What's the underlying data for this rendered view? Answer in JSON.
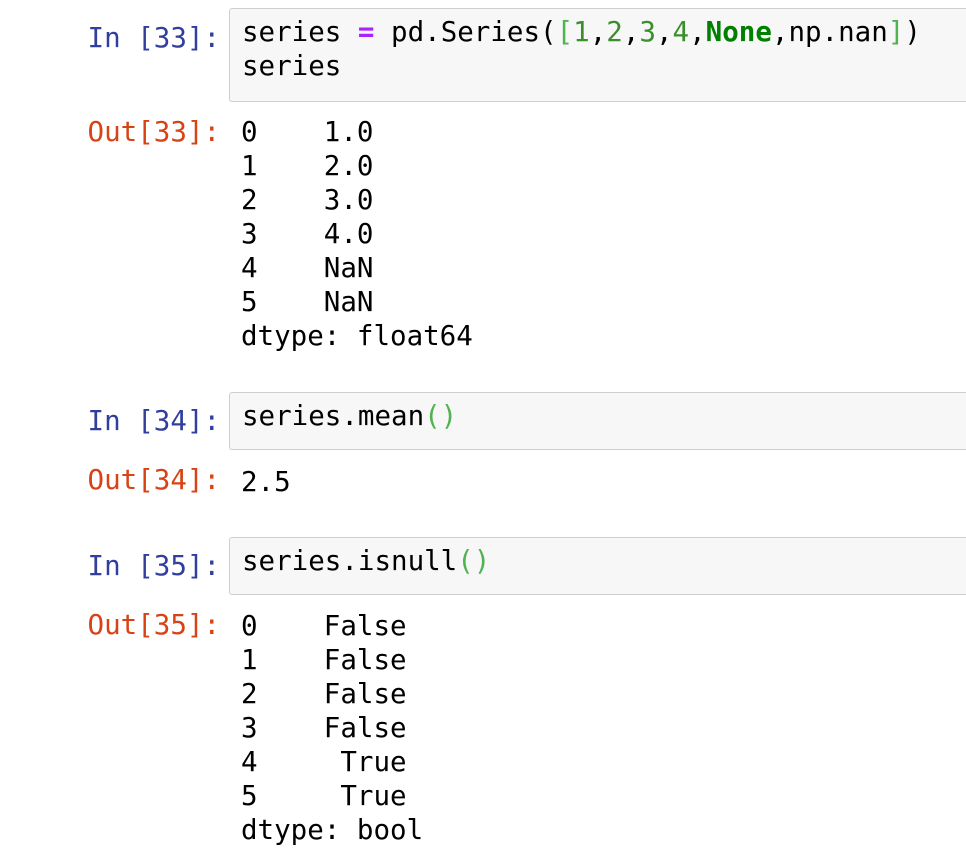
{
  "cells": [
    {
      "in_prompt": "In [33]:",
      "code_lines": [
        "series = pd.Series([1,2,3,4,None,np.nan])",
        "series"
      ],
      "out_prompt": "Out[33]:",
      "output_lines": [
        "0    1.0",
        "1    2.0",
        "2    3.0",
        "3    4.0",
        "4    NaN",
        "5    NaN",
        "dtype: float64"
      ]
    },
    {
      "in_prompt": "In [34]:",
      "code_lines": [
        "series.mean()"
      ],
      "out_prompt": "Out[34]:",
      "output_lines": [
        "2.5"
      ]
    },
    {
      "in_prompt": "In [35]:",
      "code_lines": [
        "series.isnull()"
      ],
      "out_prompt": "Out[35]:",
      "output_lines": [
        "0    False",
        "1    False",
        "2    False",
        "3    False",
        "4     True",
        "5     True",
        "dtype: bool"
      ]
    }
  ],
  "colors": {
    "in_prompt": "#303f9f",
    "out_prompt": "#d84315",
    "input_bg": "#f7f7f7",
    "input_border": "#cfcfcf",
    "operator": "#aa22ff",
    "number": "#3b8f2a",
    "keyword": "#008000",
    "bracket": "#4fb34f"
  }
}
